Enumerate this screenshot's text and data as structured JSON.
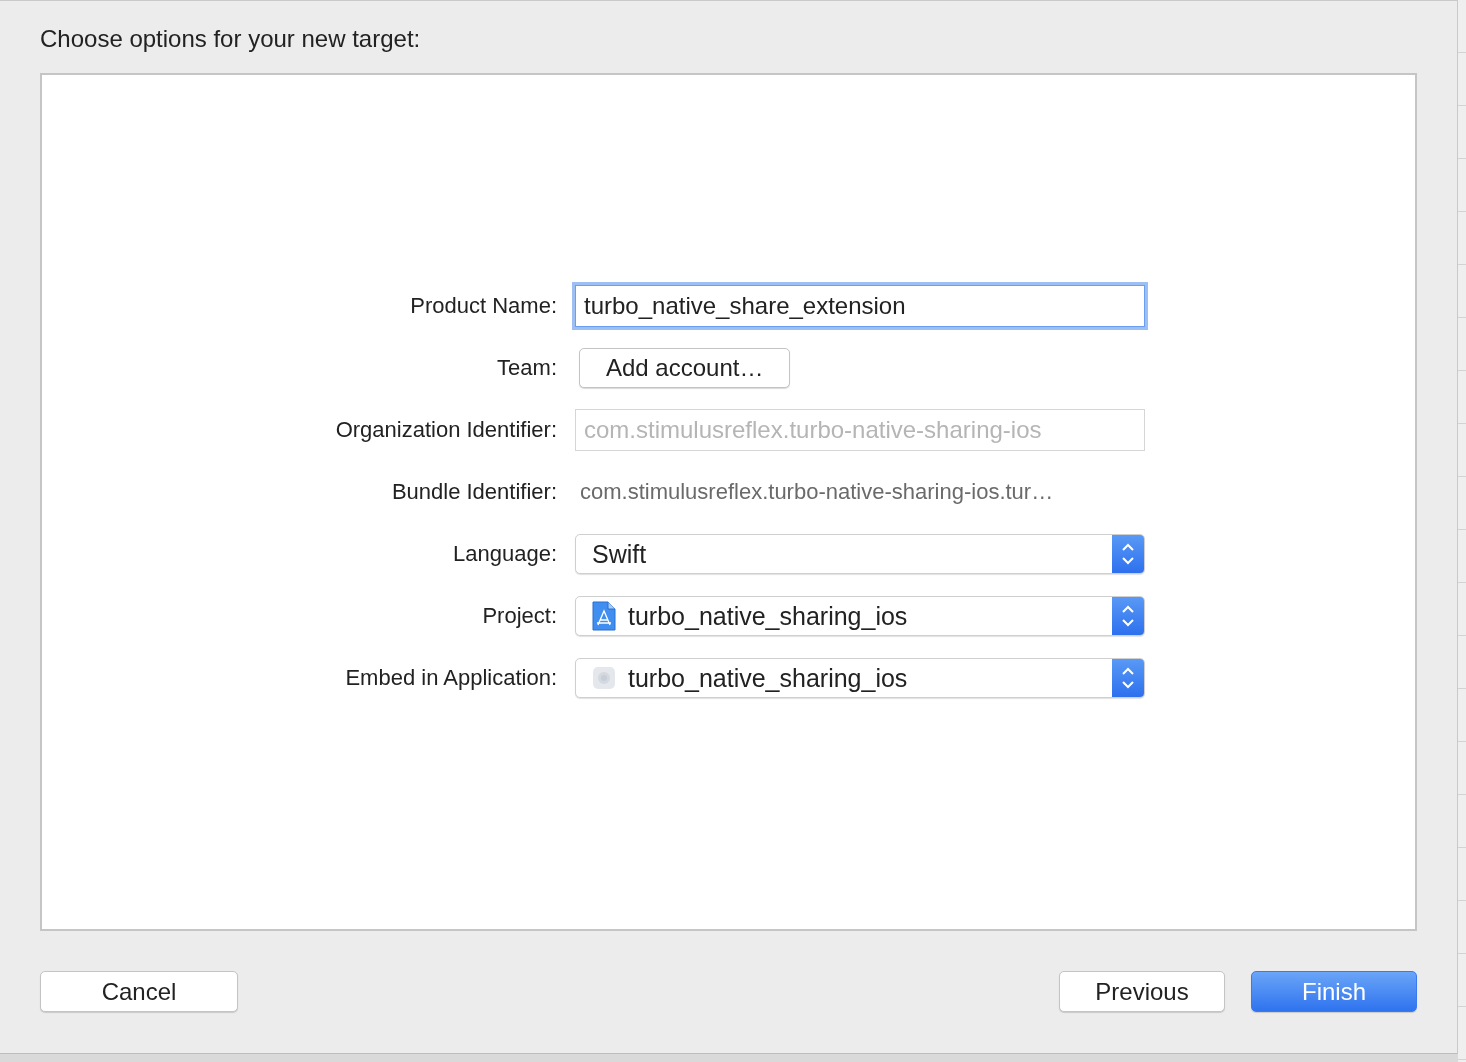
{
  "title": "Choose options for your new target:",
  "fields": [
    {
      "kind": "text",
      "label": "Product Name:",
      "value": "turbo_native_share_extension",
      "focused": true
    },
    {
      "kind": "button",
      "label": "Team:",
      "button": "Add account…"
    },
    {
      "kind": "text",
      "label": "Organization Identifier:",
      "placeholder": "com.stimulusreflex.turbo-native-sharing-ios",
      "focused": false
    },
    {
      "kind": "static",
      "label": "Bundle Identifier:",
      "value": "com.stimulusreflex.turbo-native-sharing-ios.tur…"
    },
    {
      "kind": "popup",
      "label": "Language:",
      "value": "Swift"
    },
    {
      "kind": "project-popup",
      "label": "Project:",
      "value": "turbo_native_sharing_ios"
    },
    {
      "kind": "app-popup",
      "label": "Embed in Application:",
      "value": "turbo_native_sharing_ios"
    }
  ],
  "buttons_left": [
    {
      "label": "Cancel",
      "primary": false
    }
  ],
  "buttons_right": [
    {
      "label": "Previous",
      "primary": false
    },
    {
      "label": "Finish",
      "primary": true
    }
  ]
}
